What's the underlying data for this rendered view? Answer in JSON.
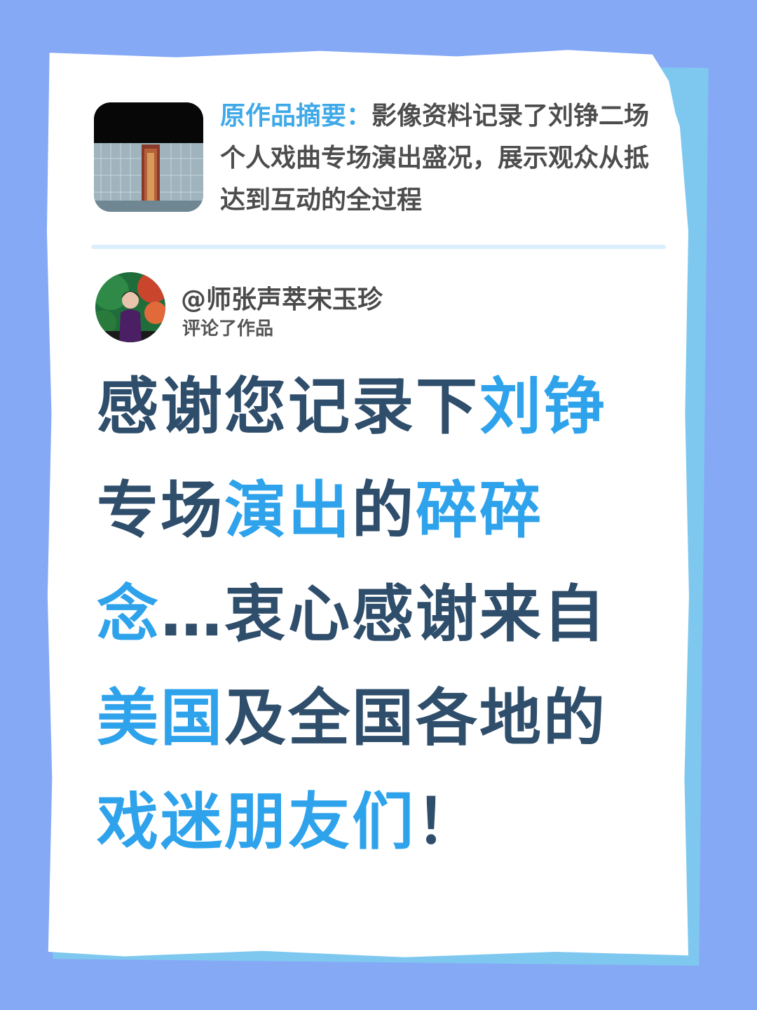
{
  "colors": {
    "background": "#86a9f6",
    "paper": "#ffffff",
    "back_sheet": "#7ec8f0",
    "accent_blue": "#2ea3ec",
    "dark_text": "#2f4e6b",
    "summary_label": "#3fa9e8",
    "divider": "#dbeefd"
  },
  "summary": {
    "label": "原作品摘要：",
    "text": "影像资料记录了刘铮二场个人戏曲专场演出盛况，展示观众从抵达到互动的全过程",
    "thumbnail_icon": "video-thumbnail-image"
  },
  "comment": {
    "handle": "@师张声萃宋玉珍",
    "action": "评论了作品",
    "avatar_icon": "user-avatar-image",
    "segments": [
      {
        "text": "感谢您记录下",
        "highlight": false
      },
      {
        "text": "刘铮",
        "highlight": true
      },
      {
        "text": "专场",
        "highlight": false
      },
      {
        "text": "演出",
        "highlight": true
      },
      {
        "text": "的",
        "highlight": false
      },
      {
        "text": "碎碎念",
        "highlight": true
      },
      {
        "text": "…衷心感谢来自",
        "highlight": false
      },
      {
        "text": "美国",
        "highlight": true
      },
      {
        "text": "及全国各地的",
        "highlight": false
      },
      {
        "text": "戏迷朋友们",
        "highlight": true
      },
      {
        "text": "！",
        "highlight": false
      }
    ]
  }
}
